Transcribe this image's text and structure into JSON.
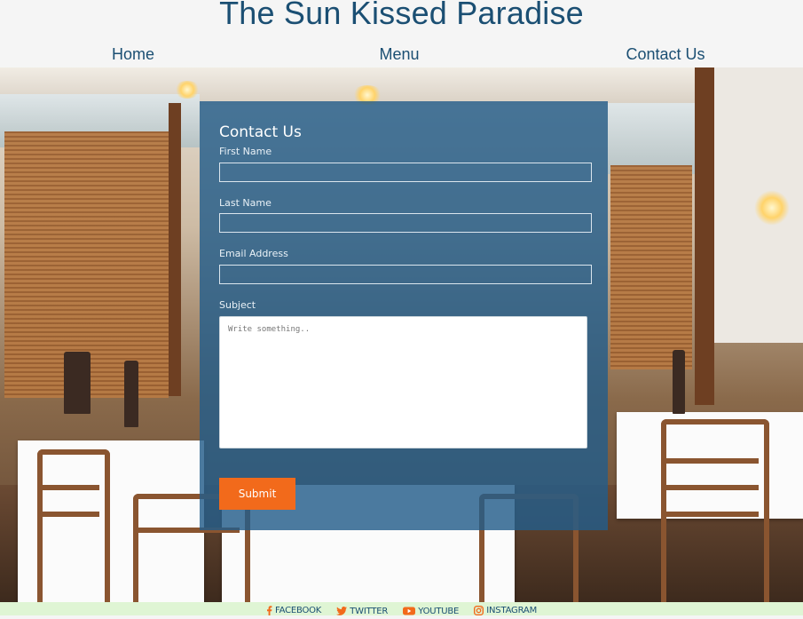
{
  "site": {
    "title": "The Sun Kissed Paradise"
  },
  "nav": {
    "items": [
      {
        "label": "Home"
      },
      {
        "label": "Menu"
      },
      {
        "label": "Contact Us"
      }
    ]
  },
  "contact_form": {
    "title": "Contact Us",
    "first_name": {
      "label": "First Name",
      "value": ""
    },
    "last_name": {
      "label": "Last Name",
      "value": ""
    },
    "email": {
      "label": "Email Address",
      "value": ""
    },
    "subject": {
      "label": "Subject",
      "placeholder": "Write something..",
      "value": ""
    },
    "submit_label": "Submit"
  },
  "footer": {
    "links": [
      {
        "label": "FACEBOOK",
        "icon": "facebook-icon"
      },
      {
        "label": "TWITTER",
        "icon": "twitter-icon"
      },
      {
        "label": "YOUTUBE",
        "icon": "youtube-icon"
      },
      {
        "label": "INSTAGRAM",
        "icon": "instagram-icon"
      }
    ]
  },
  "colors": {
    "brand": "#1b4f73",
    "panel": "#235d8a",
    "submit": "#f26a1b",
    "footer_bg": "#dff5d4",
    "header_bg": "#f5f5f5"
  }
}
